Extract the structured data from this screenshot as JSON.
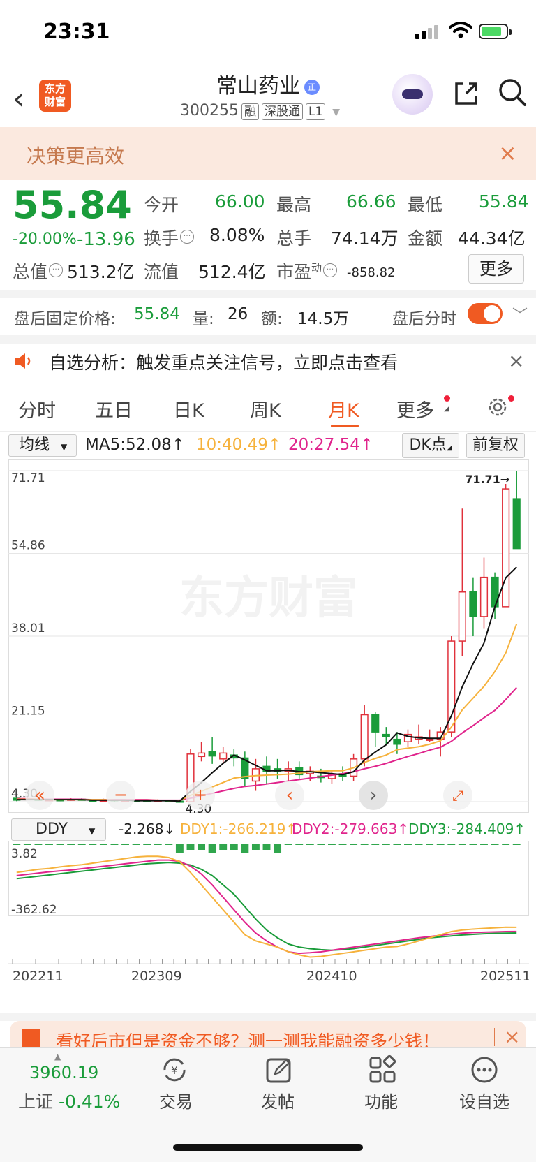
{
  "status": {
    "time": "23:31"
  },
  "header": {
    "back_icon": "chevron-left-icon",
    "logo_line1": "东方",
    "logo_line2": "财富",
    "title": "常山药业",
    "title_badge": "正",
    "code": "300255",
    "tags": [
      "融",
      "深股通",
      "L1"
    ]
  },
  "banner": {
    "text": "决策更高效",
    "close": "×"
  },
  "quote": {
    "price": "55.84",
    "change_pct": "-20.00%",
    "change_val": "-13.96",
    "rows": [
      [
        {
          "label": "今开",
          "value": "66.00"
        },
        {
          "label": "最高",
          "value": "66.66"
        },
        {
          "label": "最低",
          "value": "55.84"
        }
      ],
      [
        {
          "label": "换手",
          "value": "8.08%"
        },
        {
          "label": "总手",
          "value": "74.14万"
        },
        {
          "label": "金额",
          "value": "44.34亿"
        }
      ]
    ],
    "total_cap_label": "总值",
    "total_cap": "513.2亿",
    "float_cap_label": "流值",
    "float_cap": "512.4亿",
    "pe_label": "市盈",
    "pe_sup": "动",
    "pe": "-858.82",
    "more": "更多"
  },
  "after_hours": {
    "label": "盘后固定价格:",
    "price": "55.84",
    "vol_label": "量:",
    "vol": "26",
    "amt_label": "额:",
    "amt": "14.5万",
    "timeshare_label": "盘后分时"
  },
  "notice": {
    "text": "自选分析：触发重点关注信号，立即点击查看",
    "icon": "speaker-icon"
  },
  "tabs": [
    "分时",
    "五日",
    "日K",
    "周K",
    "月K",
    "更多"
  ],
  "active_tab": "月K",
  "ma_bar": {
    "select": "均线",
    "ma5": "MA5:52.08↑",
    "ma10": "10:40.49↑",
    "ma20": "20:27.54↑",
    "dk": "DK点",
    "adjust": "前复权"
  },
  "colors": {
    "up": "#e0313b",
    "down": "#1a9c3a",
    "ma5": "#111111",
    "ma10": "#f6b23c",
    "ma20": "#e0248c",
    "accent": "#f05a22"
  },
  "chart_data": {
    "type": "candlestick",
    "title": "",
    "y_ticks": [
      "71.71",
      "54.86",
      "38.01",
      "21.15",
      "4.30"
    ],
    "ylim": [
      4.3,
      71.71
    ],
    "max_label": "71.71→",
    "min_label": "4.30",
    "x_labels": [
      "202211",
      "202309",
      "202410",
      "202511"
    ],
    "candles": [
      {
        "o": 5.0,
        "c": 4.6,
        "h": 5.2,
        "l": 4.4
      },
      {
        "o": 4.7,
        "c": 4.9,
        "h": 5.1,
        "l": 4.6
      },
      {
        "o": 4.8,
        "c": 4.6,
        "h": 5.0,
        "l": 4.5
      },
      {
        "o": 4.6,
        "c": 4.7,
        "h": 4.9,
        "l": 4.4
      },
      {
        "o": 4.7,
        "c": 4.5,
        "h": 4.9,
        "l": 4.4
      },
      {
        "o": 4.6,
        "c": 4.8,
        "h": 5.0,
        "l": 4.5
      },
      {
        "o": 4.8,
        "c": 4.6,
        "h": 5.0,
        "l": 4.5
      },
      {
        "o": 4.6,
        "c": 4.4,
        "h": 4.8,
        "l": 4.3
      },
      {
        "o": 4.4,
        "c": 4.7,
        "h": 4.9,
        "l": 4.3
      },
      {
        "o": 4.7,
        "c": 4.5,
        "h": 4.8,
        "l": 4.3
      },
      {
        "o": 4.5,
        "c": 4.6,
        "h": 4.8,
        "l": 4.4
      },
      {
        "o": 4.6,
        "c": 4.5,
        "h": 4.8,
        "l": 4.3
      },
      {
        "o": 4.5,
        "c": 4.4,
        "h": 4.7,
        "l": 4.3
      },
      {
        "o": 4.4,
        "c": 4.5,
        "h": 4.8,
        "l": 4.3
      },
      {
        "o": 4.5,
        "c": 4.4,
        "h": 4.7,
        "l": 4.3
      },
      {
        "o": 4.4,
        "c": 4.3,
        "h": 4.6,
        "l": 4.3
      },
      {
        "o": 4.3,
        "c": 14.0,
        "h": 15.0,
        "l": 4.3
      },
      {
        "o": 13.5,
        "c": 14.2,
        "h": 16.5,
        "l": 12.5
      },
      {
        "o": 14.5,
        "c": 13.6,
        "h": 17.5,
        "l": 12.0
      },
      {
        "o": 13.0,
        "c": 14.2,
        "h": 15.5,
        "l": 12.0
      },
      {
        "o": 13.8,
        "c": 13.2,
        "h": 15.0,
        "l": 11.5
      },
      {
        "o": 13.2,
        "c": 9.0,
        "h": 14.5,
        "l": 7.5
      },
      {
        "o": 8.5,
        "c": 11.0,
        "h": 13.0,
        "l": 6.5
      },
      {
        "o": 11.5,
        "c": 10.5,
        "h": 13.5,
        "l": 8.0
      },
      {
        "o": 11.0,
        "c": 10.5,
        "h": 13.0,
        "l": 9.0
      },
      {
        "o": 10.5,
        "c": 11.0,
        "h": 12.5,
        "l": 8.5
      },
      {
        "o": 11.3,
        "c": 9.8,
        "h": 12.5,
        "l": 9.0
      },
      {
        "o": 10.0,
        "c": 10.5,
        "h": 11.5,
        "l": 8.5
      },
      {
        "o": 9.5,
        "c": 9.2,
        "h": 11.0,
        "l": 8.2
      },
      {
        "o": 9.0,
        "c": 9.8,
        "h": 10.5,
        "l": 8.0
      },
      {
        "o": 10.0,
        "c": 9.5,
        "h": 11.5,
        "l": 8.5
      },
      {
        "o": 9.5,
        "c": 13.0,
        "h": 14.0,
        "l": 8.5
      },
      {
        "o": 13.0,
        "c": 22.0,
        "h": 24.0,
        "l": 11.5
      },
      {
        "o": 22.0,
        "c": 18.5,
        "h": 22.5,
        "l": 15.5
      },
      {
        "o": 18.0,
        "c": 17.5,
        "h": 19.5,
        "l": 16.0
      },
      {
        "o": 17.0,
        "c": 16.0,
        "h": 18.5,
        "l": 14.0
      },
      {
        "o": 16.5,
        "c": 18.0,
        "h": 19.0,
        "l": 15.5
      },
      {
        "o": 17.0,
        "c": 17.5,
        "h": 20.0,
        "l": 16.0
      },
      {
        "o": 17.0,
        "c": 17.0,
        "h": 19.0,
        "l": 16.5
      },
      {
        "o": 17.0,
        "c": 18.5,
        "h": 19.5,
        "l": 13.5
      },
      {
        "o": 18.5,
        "c": 37.0,
        "h": 38.0,
        "l": 17.5
      },
      {
        "o": 37.0,
        "c": 47.0,
        "h": 64.0,
        "l": 34.0
      },
      {
        "o": 47.0,
        "c": 42.0,
        "h": 50.0,
        "l": 38.0
      },
      {
        "o": 42.0,
        "c": 50.0,
        "h": 54.0,
        "l": 39.5
      },
      {
        "o": 50.0,
        "c": 44.0,
        "h": 51.0,
        "l": 41.5
      },
      {
        "o": 44.0,
        "c": 68.0,
        "h": 69.0,
        "l": 44.0
      },
      {
        "o": 66.0,
        "c": 55.84,
        "h": 71.71,
        "l": 55.84
      }
    ],
    "ma5": [
      4.7,
      4.7,
      4.7,
      4.7,
      4.7,
      4.7,
      4.7,
      4.6,
      4.6,
      4.6,
      4.6,
      4.5,
      4.5,
      4.5,
      4.5,
      4.4,
      6.4,
      8.2,
      10.2,
      12.1,
      13.8,
      12.8,
      11.7,
      10.6,
      10.6,
      10.7,
      10.4,
      10.4,
      10.2,
      10.0,
      9.8,
      10.4,
      12.8,
      14.4,
      15.9,
      18.3,
      17.6,
      17.3,
      17.2,
      17.2,
      21.8,
      27.7,
      32.4,
      36.6,
      44.0,
      49.9,
      52.08
    ],
    "ma10": [
      4.8,
      4.8,
      4.8,
      4.7,
      4.7,
      4.7,
      4.7,
      4.7,
      4.7,
      4.6,
      4.6,
      4.6,
      4.6,
      4.6,
      4.5,
      4.5,
      5.6,
      6.4,
      7.3,
      8.2,
      9.1,
      9.4,
      9.6,
      9.7,
      9.8,
      9.9,
      10.1,
      10.4,
      10.5,
      10.6,
      10.6,
      11.2,
      12.3,
      13.1,
      13.8,
      14.9,
      15.2,
      15.5,
      16.0,
      16.7,
      19.5,
      23.0,
      25.4,
      27.8,
      30.8,
      34.6,
      40.49
    ],
    "ma20": [
      4.9,
      4.9,
      4.8,
      4.8,
      4.8,
      4.8,
      4.8,
      4.7,
      4.7,
      4.7,
      4.7,
      4.7,
      4.7,
      4.6,
      4.6,
      4.6,
      5.0,
      5.5,
      6.0,
      6.5,
      7.0,
      7.4,
      7.6,
      7.9,
      8.2,
      8.5,
      8.8,
      9.1,
      9.4,
      9.7,
      10.0,
      10.4,
      11.0,
      11.5,
      12.1,
      12.8,
      13.5,
      14.1,
      14.8,
      15.4,
      16.6,
      18.3,
      19.8,
      21.4,
      22.9,
      25.1,
      27.54
    ]
  },
  "ddy": {
    "select": "DDY",
    "val": "-2.268↓",
    "ddy1": "DDY1:-266.219↑",
    "ddy2": "DDY2:-279.663↑",
    "ddy3": "DDY3:-284.409↑",
    "top_label": "3.82",
    "bottom_label": "-362.62",
    "ddy1_series": [
      -90,
      -85,
      -80,
      -77,
      -72,
      -68,
      -65,
      -60,
      -55,
      -50,
      -45,
      -40,
      -38,
      -38,
      -42,
      -55,
      -90,
      -130,
      -170,
      -210,
      -250,
      -290,
      -310,
      -320,
      -330,
      -345,
      -355,
      -362,
      -360,
      -355,
      -350,
      -345,
      -340,
      -335,
      -330,
      -328,
      -320,
      -310,
      -300,
      -290,
      -280,
      -275,
      -272,
      -270,
      -268,
      -266,
      -266.219
    ],
    "ddy2_series": [
      -100,
      -96,
      -92,
      -88,
      -85,
      -82,
      -78,
      -74,
      -70,
      -66,
      -62,
      -58,
      -54,
      -50,
      -50,
      -54,
      -70,
      -95,
      -130,
      -170,
      -210,
      -250,
      -285,
      -310,
      -330,
      -345,
      -350,
      -348,
      -345,
      -340,
      -335,
      -330,
      -325,
      -320,
      -315,
      -310,
      -305,
      -300,
      -296,
      -292,
      -288,
      -285,
      -283,
      -282,
      -281,
      -280,
      -279.663
    ],
    "ddy3_series": [
      -110,
      -106,
      -102,
      -98,
      -94,
      -90,
      -86,
      -82,
      -78,
      -74,
      -70,
      -66,
      -62,
      -60,
      -58,
      -60,
      -66,
      -80,
      -100,
      -130,
      -160,
      -200,
      -240,
      -275,
      -300,
      -320,
      -330,
      -335,
      -338,
      -340,
      -338,
      -335,
      -330,
      -325,
      -320,
      -315,
      -310,
      -305,
      -300,
      -297,
      -294,
      -291,
      -289,
      -287,
      -286,
      -285,
      -284.409
    ],
    "x_labels": [
      "202211",
      "202309",
      "202410",
      "202511"
    ]
  },
  "promo": {
    "text": "看好后市但是资金不够？测一测我能融资多少钱！",
    "close": "×"
  },
  "bottom_nav": {
    "index_value": "3960.19",
    "index_name": "上证",
    "index_change": "-0.41%",
    "items": [
      {
        "label": "交易",
        "icon": "yuan-exchange-icon"
      },
      {
        "label": "发帖",
        "icon": "edit-icon"
      },
      {
        "label": "功能",
        "icon": "grid-icon"
      },
      {
        "label": "设自选",
        "icon": "more-circle-icon"
      }
    ]
  }
}
